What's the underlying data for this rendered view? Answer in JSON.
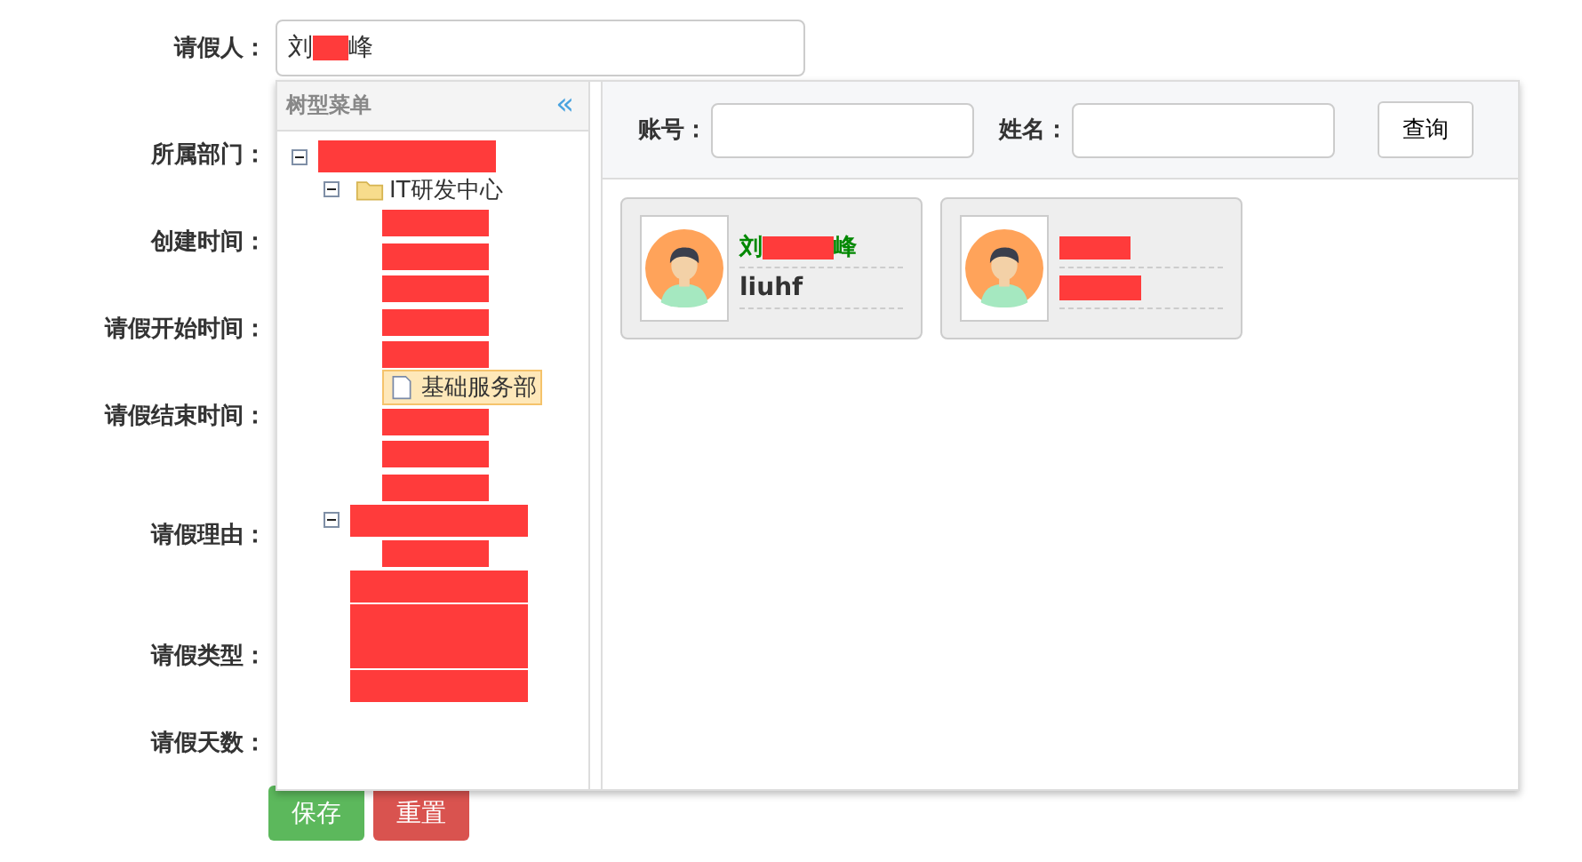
{
  "form": {
    "fields": [
      {
        "label": "请假人：",
        "kind": "person",
        "value_before": "刘",
        "value_after": "峰",
        "redacted": true
      },
      {
        "label": "所属部门：",
        "kind": "plain"
      },
      {
        "label": "创建时间：",
        "kind": "plain"
      },
      {
        "label": "请假开始时间：",
        "kind": "plain"
      },
      {
        "label": "请假结束时间：",
        "kind": "plain"
      },
      {
        "label": "请假理由：",
        "kind": "tall"
      },
      {
        "label": "请假类型：",
        "kind": "plain"
      },
      {
        "label": "请假天数：",
        "kind": "plain"
      }
    ],
    "buttons": [
      {
        "label": "保存",
        "kind": "primary"
      },
      {
        "label": "重置",
        "kind": "danger"
      }
    ]
  },
  "tree_panel": {
    "title": "树型菜单",
    "collapse_glyph": "«",
    "items": [
      {
        "kind": "folder",
        "redacted": true,
        "expanded": true,
        "children": [
          {
            "kind": "folder",
            "label": "IT研发中心",
            "redacted": false,
            "selected": false,
            "expanded": true,
            "children": [
              {
                "kind": "file",
                "redacted": true
              },
              {
                "kind": "file",
                "redacted": true
              },
              {
                "kind": "file",
                "redacted": true
              },
              {
                "kind": "file",
                "redacted": true
              },
              {
                "kind": "file",
                "redacted": true
              },
              {
                "kind": "file",
                "label": "基础服务部",
                "redacted": false,
                "selected": true
              },
              {
                "kind": "file",
                "redacted": true
              },
              {
                "kind": "file",
                "redacted": true
              },
              {
                "kind": "file",
                "redacted": true
              }
            ]
          },
          {
            "kind": "folder",
            "redacted": true,
            "expanded": true,
            "children": [
              {
                "kind": "file",
                "redacted": true
              }
            ]
          },
          {
            "kind": "folder",
            "redacted": true,
            "expanded": false
          },
          {
            "kind": "folder",
            "redacted": true,
            "expanded": false
          },
          {
            "kind": "folder",
            "redacted": true,
            "expanded": false
          },
          {
            "kind": "folder",
            "redacted": true,
            "expanded": false
          }
        ]
      }
    ]
  },
  "search": {
    "fields": [
      {
        "label": "账号："
      },
      {
        "label": "姓名："
      }
    ],
    "button": "查询"
  },
  "users": [
    {
      "name_before": "刘",
      "name_after": "峰",
      "name_redacted": true,
      "account": "liuhf",
      "account_redacted": false
    },
    {
      "name_redacted": true,
      "account_redacted": true
    }
  ]
}
